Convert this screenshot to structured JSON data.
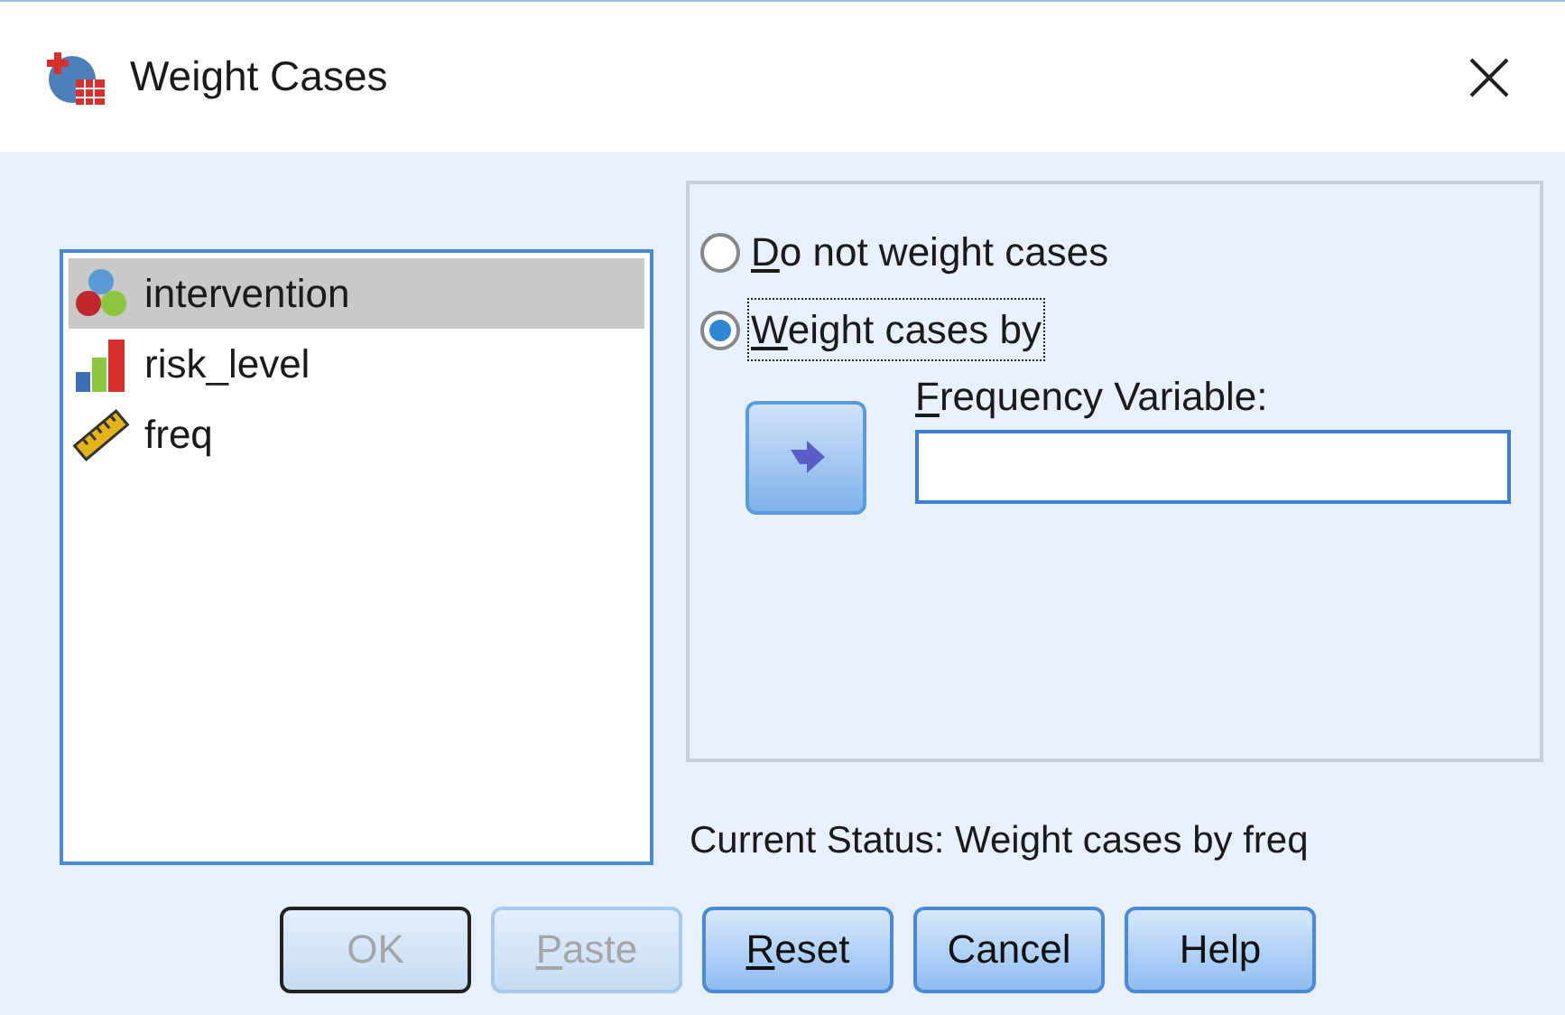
{
  "window": {
    "title": "Weight Cases"
  },
  "variables": [
    {
      "name": "intervention",
      "kind": "nominal",
      "selected": true
    },
    {
      "name": "risk_level",
      "kind": "ordinal",
      "selected": false
    },
    {
      "name": "freq",
      "kind": "scale",
      "selected": false
    }
  ],
  "options": [
    {
      "label": "Do not weight cases",
      "selected": false,
      "mnemonic": true,
      "focused": false
    },
    {
      "label": "Weight cases by",
      "selected": true,
      "mnemonic": true,
      "focused": true
    }
  ],
  "frequency_variable": {
    "label": "Frequency Variable:",
    "mnemonic": true
  },
  "current_status": "Current Status: Weight cases by freq",
  "buttons": [
    {
      "label": "OK",
      "disabled": true,
      "default": true,
      "mnemonic": false
    },
    {
      "label": "Paste",
      "disabled": true,
      "default": false,
      "mnemonic": true
    },
    {
      "label": "Reset",
      "disabled": false,
      "default": false,
      "mnemonic": true
    },
    {
      "label": "Cancel",
      "disabled": false,
      "default": false,
      "mnemonic": false
    },
    {
      "label": "Help",
      "disabled": false,
      "default": false,
      "mnemonic": false
    }
  ]
}
